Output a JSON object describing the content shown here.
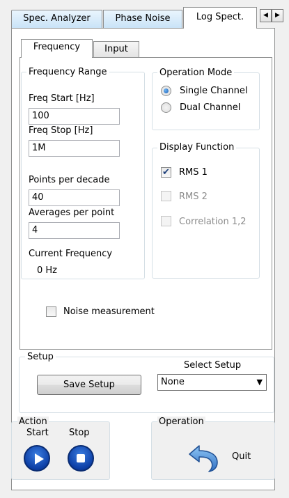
{
  "tabs": {
    "spec_analyzer": "Spec. Analyzer",
    "phase_noise": "Phase Noise",
    "log_spect": "Log Spect."
  },
  "inner_tabs": {
    "frequency": "Frequency",
    "input": "Input"
  },
  "frequency_range": {
    "title": "Frequency Range",
    "freq_start_label": "Freq Start [Hz]",
    "freq_start_value": "100",
    "freq_stop_label": "Freq Stop [Hz]",
    "freq_stop_value": "1M",
    "points_label": "Points per decade",
    "points_value": "40",
    "averages_label": "Averages per point",
    "averages_value": "4",
    "current_freq_label": "Current Frequency",
    "current_freq_value": "0 Hz"
  },
  "operation_mode": {
    "title": "Operation Mode",
    "single": "Single Channel",
    "dual": "Dual Channel",
    "selected": "single"
  },
  "display_function": {
    "title": "Display Function",
    "rms1": "RMS 1",
    "rms2": "RMS 2",
    "correlation": "Correlation 1,2",
    "rms1_checked": true,
    "rms2_enabled": false,
    "correlation_enabled": false
  },
  "noise_measurement": {
    "label": "Noise measurement",
    "checked": false
  },
  "setup": {
    "title": "Setup",
    "save_label": "Save Setup",
    "select_label": "Select Setup",
    "select_value": "None"
  },
  "action": {
    "title": "Action",
    "start": "Start",
    "stop": "Stop"
  },
  "operation": {
    "title": "Operation",
    "quit": "Quit"
  },
  "colors": {
    "accent_blue": "#1b5fb5",
    "check_mark": "#1c3f7a",
    "disabled_text": "#8c8c8c"
  }
}
